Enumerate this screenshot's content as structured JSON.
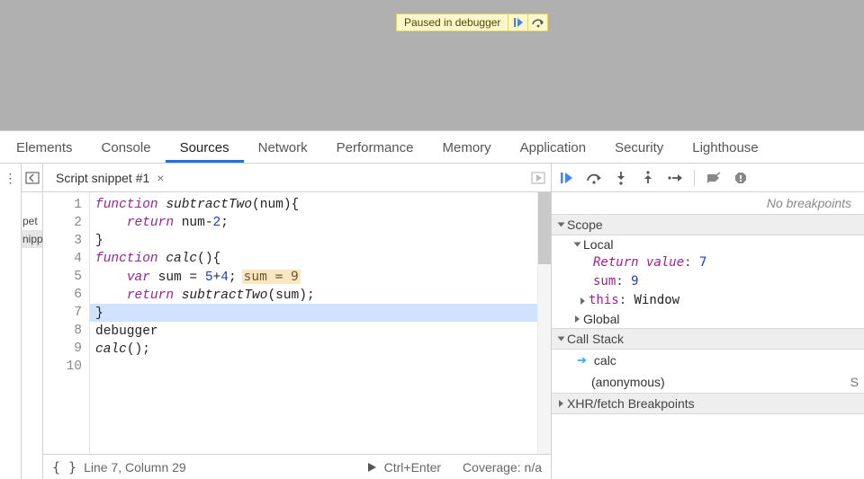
{
  "pause_pill": {
    "text": "Paused in debugger"
  },
  "main_tabs": [
    "Elements",
    "Console",
    "Sources",
    "Network",
    "Performance",
    "Memory",
    "Application",
    "Security",
    "Lighthouse"
  ],
  "main_tab_active": 2,
  "nav_panel": {
    "items": [
      "pet",
      "nipp"
    ],
    "selected": 1
  },
  "editor": {
    "tab_name": "Script snippet #1",
    "lines": [
      {
        "n": 1,
        "segs": [
          [
            "kw",
            "function"
          ],
          [
            "txt",
            " "
          ],
          [
            "fn",
            "subtractTwo"
          ],
          [
            "txt",
            "(num){"
          ]
        ]
      },
      {
        "n": 2,
        "segs": [
          [
            "txt",
            "    "
          ],
          [
            "kw",
            "return"
          ],
          [
            "txt",
            " num-"
          ],
          [
            "num",
            "2"
          ],
          [
            "txt",
            ";"
          ]
        ]
      },
      {
        "n": 3,
        "segs": [
          [
            "txt",
            "}"
          ]
        ]
      },
      {
        "n": 4,
        "segs": [
          [
            "txt",
            ""
          ]
        ]
      },
      {
        "n": 5,
        "segs": [
          [
            "kw",
            "function"
          ],
          [
            "txt",
            " "
          ],
          [
            "fn",
            "calc"
          ],
          [
            "txt",
            "(){"
          ]
        ]
      },
      {
        "n": 6,
        "segs": [
          [
            "txt",
            "    "
          ],
          [
            "kw",
            "var"
          ],
          [
            "txt",
            " sum = "
          ],
          [
            "num",
            "5"
          ],
          [
            "txt",
            "+"
          ],
          [
            "num",
            "4"
          ],
          [
            "txt",
            ";"
          ]
        ],
        "hint": "sum = 9"
      },
      {
        "n": 7,
        "segs": [
          [
            "txt",
            "    "
          ],
          [
            "kw",
            "return"
          ],
          [
            "txt",
            " "
          ],
          [
            "fn",
            "subtractTwo"
          ],
          [
            "txt",
            "(sum);"
          ]
        ],
        "hl": true
      },
      {
        "n": 8,
        "segs": [
          [
            "txt",
            "}"
          ]
        ]
      },
      {
        "n": 9,
        "segs": [
          [
            "txt",
            "debugger"
          ]
        ]
      },
      {
        "n": 10,
        "segs": [
          [
            "fn",
            "calc"
          ],
          [
            "txt",
            "();"
          ]
        ]
      }
    ],
    "status": {
      "cursor": "Line 7, Column 29",
      "run_hint": "Ctrl+Enter",
      "coverage": "Coverage: n/a"
    }
  },
  "debug": {
    "no_bp": "No breakpoints",
    "scope_header": "Scope",
    "scope": {
      "local_label": "Local",
      "return_label": "Return value",
      "return_value": "7",
      "sum_label": "sum",
      "sum_value": "9",
      "this_label": "this",
      "this_value": "Window",
      "global_label": "Global"
    },
    "callstack_header": "Call Stack",
    "stack": [
      {
        "name": "calc",
        "current": true
      },
      {
        "name": "(anonymous)",
        "right": "S"
      }
    ],
    "xhr_header": "XHR/fetch Breakpoints"
  }
}
